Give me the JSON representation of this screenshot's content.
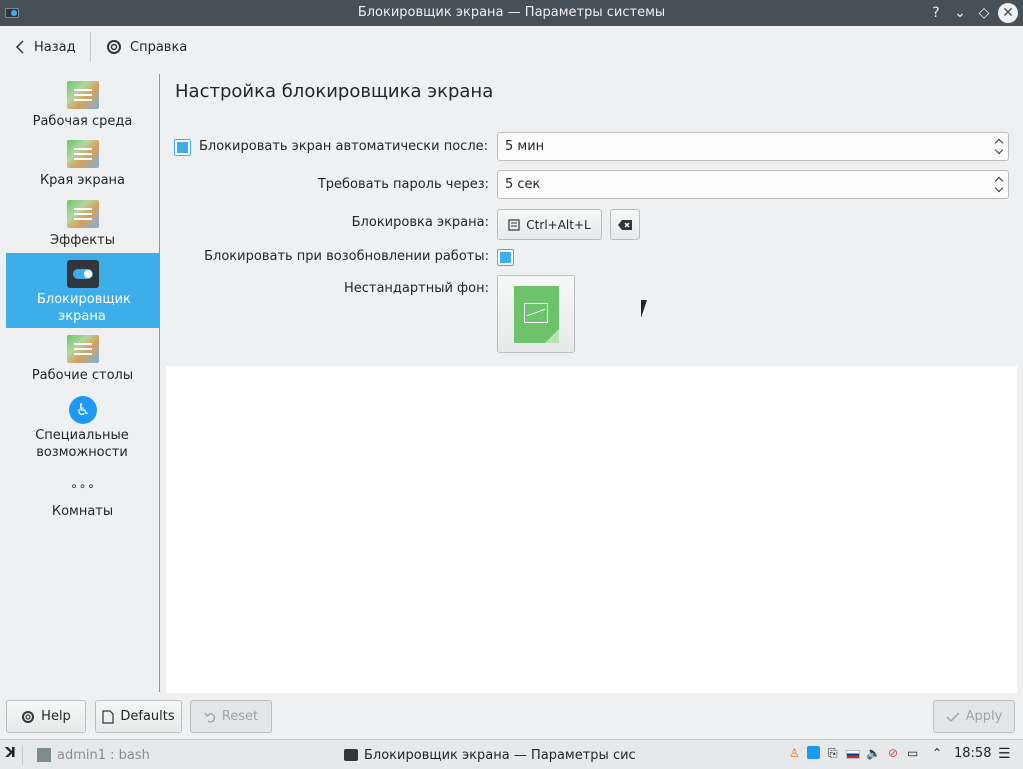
{
  "window": {
    "title": "Блокировщик экрана  — Параметры системы",
    "buttons": [
      "?",
      "⌄",
      "◇",
      "✕"
    ]
  },
  "toolbar": {
    "back_label": "Назад",
    "help_label": "Справка"
  },
  "sidebar": {
    "items": [
      {
        "label": "Рабочая среда",
        "icon": "workspace-icon",
        "active": false
      },
      {
        "label": "Края экрана",
        "icon": "screen-edges-icon",
        "active": false
      },
      {
        "label": "Эффекты",
        "icon": "effects-icon",
        "active": false
      },
      {
        "label": "Блокировщик экрана",
        "icon": "screen-locker-icon",
        "active": true
      },
      {
        "label": "Рабочие столы",
        "icon": "virtual-desktops-icon",
        "active": false
      },
      {
        "label": "Специальные возможности",
        "icon": "accessibility-icon",
        "active": false
      },
      {
        "label": "Комнаты",
        "icon": "activities-icon",
        "active": false
      }
    ]
  },
  "main": {
    "title": "Настройка блокировщика экрана",
    "lock_auto_label": "Блокировать экран автоматически после:",
    "lock_auto_checked": true,
    "lock_auto_value": "5 мин",
    "password_label": "Требовать пароль через:",
    "password_value": "5 сек",
    "shortcut_label": "Блокировка экрана:",
    "shortcut_value": "Ctrl+Alt+L",
    "resume_label": "Блокировать при возобновлении работы:",
    "resume_checked": true,
    "background_label": "Нестандартный фон:"
  },
  "footer": {
    "help": "Help",
    "defaults": "Defaults",
    "reset": "Reset",
    "apply": "Apply"
  },
  "taskbar": {
    "tasks": [
      {
        "label": "admin1 : bash",
        "active": false
      },
      {
        "label": "Блокировщик экрана  — Параметры сис",
        "active": true
      }
    ],
    "clock": "18:58"
  },
  "colors": {
    "accent": "#3daee9",
    "titlebar": "#475057",
    "window_bg": "#eff0f1"
  }
}
